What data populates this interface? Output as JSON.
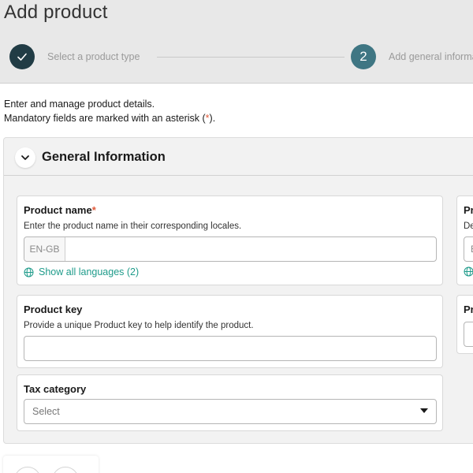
{
  "page": {
    "title": "Add product"
  },
  "stepper": {
    "step1": {
      "label": "Select a product type",
      "status": "completed"
    },
    "step2": {
      "number": "2",
      "label": "Add general information"
    }
  },
  "intro": {
    "line1": "Enter and manage product details.",
    "line2_pre": "Mandatory fields are marked with an asterisk (",
    "line2_star": "*",
    "line2_post": ")."
  },
  "section": {
    "title": "General Information"
  },
  "fields": {
    "product_name": {
      "label": "Product name",
      "required_mark": "*",
      "description": "Enter the product name in their corresponding locales.",
      "locale": "EN-GB",
      "value": "",
      "show_languages": "Show all languages (2)"
    },
    "product_key": {
      "label": "Product key",
      "description": "Provide a unique Product key to help identify the product.",
      "value": ""
    },
    "tax_category": {
      "label": "Tax category",
      "placeholder": "Select"
    },
    "right_col_1": {
      "label": "Pr",
      "description": "De",
      "locale": "E"
    },
    "right_col_2": {
      "label": "Pr"
    }
  },
  "colors": {
    "step_completed": "#213c45",
    "step_active": "#3f7683",
    "link": "#1e9b8a",
    "asterisk": "#e05a3a"
  }
}
